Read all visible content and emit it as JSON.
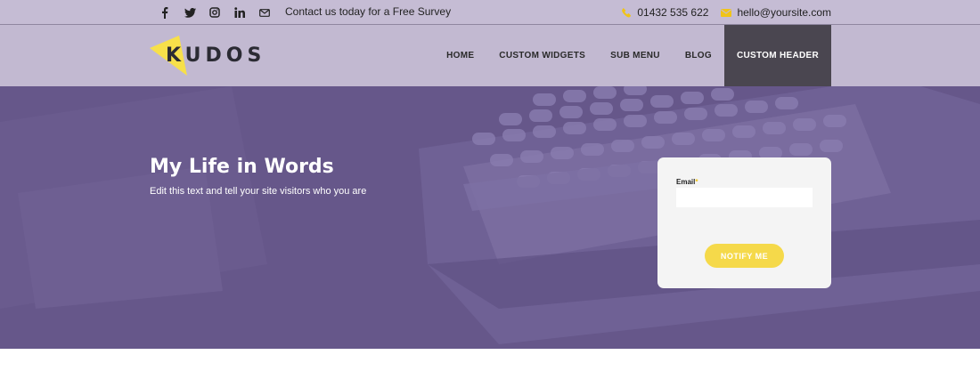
{
  "topbar": {
    "social": [
      {
        "name": "facebook-icon"
      },
      {
        "name": "twitter-icon"
      },
      {
        "name": "instagram-icon"
      },
      {
        "name": "linkedin-icon"
      },
      {
        "name": "email-icon"
      }
    ],
    "survey_text": "Contact us today for a Free Survey",
    "phone": "01432 535 622",
    "email": "hello@yoursite.com"
  },
  "header": {
    "logo_text": "KUDOS",
    "nav": [
      {
        "label": "HOME"
      },
      {
        "label": "CUSTOM WIDGETS"
      },
      {
        "label": "SUB MENU"
      },
      {
        "label": "BLOG"
      },
      {
        "label": "CUSTOM HEADER",
        "active": true
      }
    ]
  },
  "hero": {
    "title": "My Life in Words",
    "subtitle": "Edit this text and tell your site visitors who you are"
  },
  "form": {
    "email_label": "Email",
    "required_mark": "*",
    "email_value": "",
    "button_label": "NOTIFY ME"
  },
  "colors": {
    "topbar": "#c5bcd4",
    "header": "#c2b9d1",
    "hero": "#66578a",
    "accent": "#f5d94a",
    "active_nav": "#4a4650"
  }
}
